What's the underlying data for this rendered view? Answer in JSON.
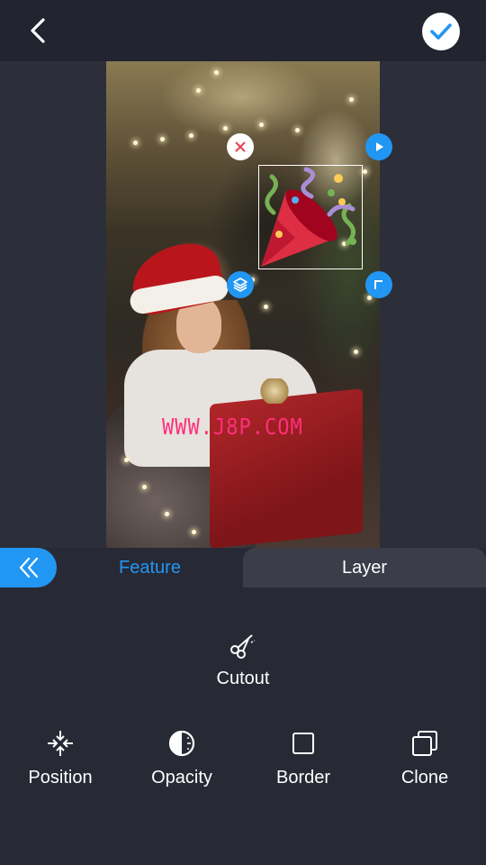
{
  "header": {
    "back_icon": "chevron-left-icon",
    "confirm_icon": "checkmark-icon"
  },
  "photo": {
    "watermark_text": "WWW.J8P.COM",
    "sticker": "party-popper",
    "handles": [
      "close-icon",
      "flip-icon",
      "layers-icon",
      "rotate-icon"
    ]
  },
  "tabs": {
    "collapse_icon": "double-chevron-left-icon",
    "feature_label": "Feature",
    "layer_label": "Layer"
  },
  "tools": {
    "cutout": {
      "label": "Cutout",
      "icon": "scissors-icon"
    },
    "position": {
      "label": "Position",
      "icon": "position-arrows-icon"
    },
    "opacity": {
      "label": "Opacity",
      "icon": "half-circle-icon"
    },
    "border": {
      "label": "Border",
      "icon": "square-icon"
    },
    "clone": {
      "label": "Clone",
      "icon": "copy-icon"
    }
  },
  "colors": {
    "accent": "#2196f3",
    "background": "#272935",
    "topbar": "#22242f",
    "tab_inactive": "#3b3d49",
    "watermark": "#ff2f7a"
  }
}
